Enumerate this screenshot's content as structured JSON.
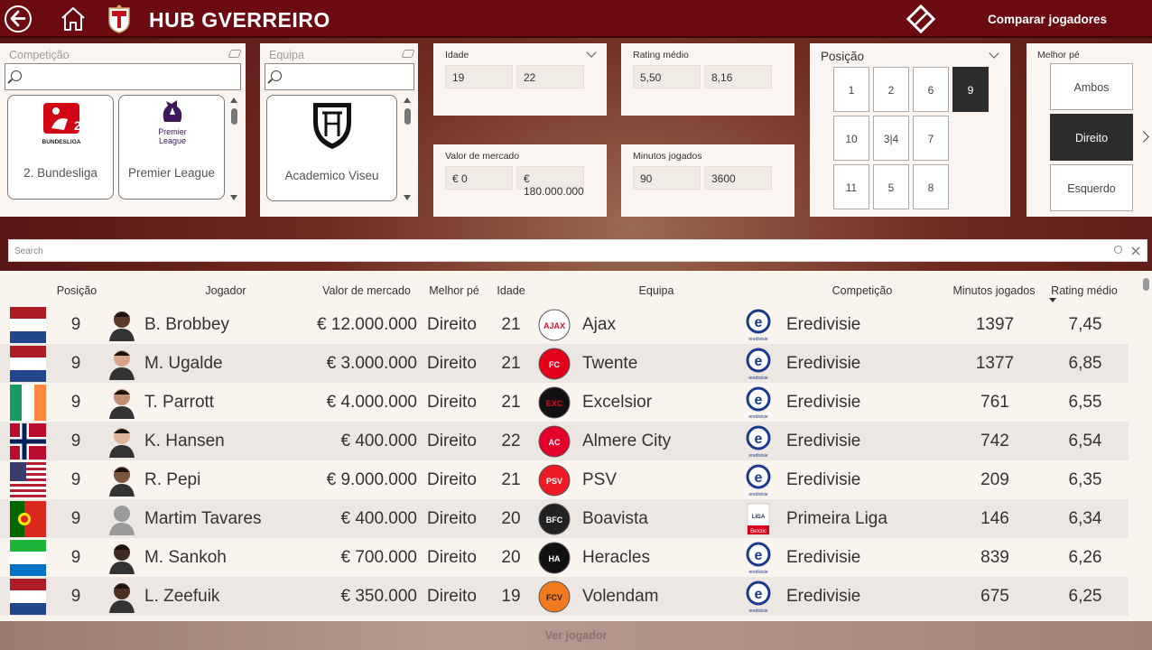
{
  "header": {
    "title": "HUB GVERREIRO",
    "compare_label": "Comparar jogadores"
  },
  "filters": {
    "competition": {
      "title": "Competição",
      "tiles": [
        "2. Bundesliga",
        "Premier League"
      ]
    },
    "team": {
      "title": "Equipa",
      "tiles": [
        "Academico Viseu"
      ]
    },
    "age": {
      "title": "Idade",
      "min": "19",
      "max": "22"
    },
    "market_value": {
      "title": "Valor de mercado",
      "min": "€ 0",
      "max": "€ 180.000.000"
    },
    "rating": {
      "title": "Rating médio",
      "min": "5,50",
      "max": "8,16"
    },
    "minutes": {
      "title": "Minutos jogados",
      "min": "90",
      "max": "3600"
    },
    "position": {
      "title": "Posição",
      "options": [
        "1",
        "2",
        "6",
        "9",
        "10",
        "3|4",
        "7",
        "11",
        "5",
        "8"
      ],
      "selected": "9"
    },
    "foot": {
      "title": "Melhor pé",
      "options": [
        "Ambos",
        "Direito",
        "Esquerdo"
      ],
      "selected": "Direito"
    }
  },
  "table": {
    "search_placeholder": "Search",
    "columns": [
      "Posição",
      "Jogador",
      "Valor de mercado",
      "Melhor pé",
      "Idade",
      "Equipa",
      "Competição",
      "Minutos jogados",
      "Rating médio"
    ],
    "sorted_by": "Rating médio",
    "rows": [
      {
        "flag": "netherlands",
        "position": "9",
        "player": "B. Brobbey",
        "value": "€ 12.000.000",
        "foot": "Direito",
        "age": "21",
        "team": "Ajax",
        "competition": "Eredivisie",
        "minutes": "1397",
        "rating": "7,45"
      },
      {
        "flag": "netherlands",
        "position": "9",
        "player": "M. Ugalde",
        "value": "€ 3.000.000",
        "foot": "Direito",
        "age": "21",
        "team": "Twente",
        "competition": "Eredivisie",
        "minutes": "1377",
        "rating": "6,85"
      },
      {
        "flag": "ireland",
        "position": "9",
        "player": "T. Parrott",
        "value": "€ 4.000.000",
        "foot": "Direito",
        "age": "21",
        "team": "Excelsior",
        "competition": "Eredivisie",
        "minutes": "761",
        "rating": "6,55"
      },
      {
        "flag": "norway",
        "position": "9",
        "player": "K. Hansen",
        "value": "€ 400.000",
        "foot": "Direito",
        "age": "22",
        "team": "Almere City",
        "competition": "Eredivisie",
        "minutes": "742",
        "rating": "6,54"
      },
      {
        "flag": "usa",
        "position": "9",
        "player": "R. Pepi",
        "value": "€ 9.000.000",
        "foot": "Direito",
        "age": "21",
        "team": "PSV",
        "competition": "Eredivisie",
        "minutes": "209",
        "rating": "6,35"
      },
      {
        "flag": "portugal",
        "position": "9",
        "player": "Martim Tavares",
        "value": "€ 400.000",
        "foot": "Direito",
        "age": "20",
        "team": "Boavista",
        "competition": "Primeira Liga",
        "minutes": "146",
        "rating": "6,34"
      },
      {
        "flag": "sierra-leone",
        "position": "9",
        "player": "M. Sankoh",
        "value": "€ 700.000",
        "foot": "Direito",
        "age": "20",
        "team": "Heracles",
        "competition": "Eredivisie",
        "minutes": "839",
        "rating": "6,26"
      },
      {
        "flag": "netherlands",
        "position": "9",
        "player": "L. Zeefuik",
        "value": "€ 350.000",
        "foot": "Direito",
        "age": "19",
        "team": "Volendam",
        "competition": "Eredivisie",
        "minutes": "675",
        "rating": "6,25"
      }
    ]
  },
  "colors": {
    "topbar": "#6b0a11",
    "selected": "#2d2d2d",
    "panel": "#faf5f1"
  },
  "footer": {
    "view_label": "Ver jogador"
  }
}
